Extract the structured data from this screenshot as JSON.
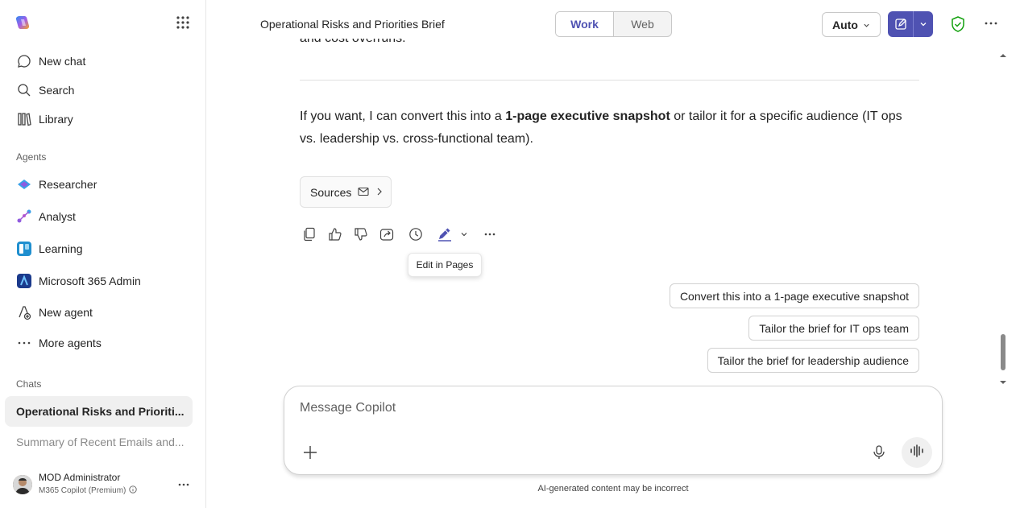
{
  "sidebar": {
    "nav": [
      {
        "label": "New chat",
        "icon": "chat-bubble-icon"
      },
      {
        "label": "Search",
        "icon": "search-icon"
      },
      {
        "label": "Library",
        "icon": "library-icon"
      }
    ],
    "agents_heading": "Agents",
    "agents": [
      {
        "label": "Researcher",
        "icon": "researcher-icon"
      },
      {
        "label": "Analyst",
        "icon": "analyst-icon"
      },
      {
        "label": "Learning",
        "icon": "learning-icon"
      },
      {
        "label": "Microsoft 365 Admin",
        "icon": "admin-icon"
      },
      {
        "label": "New agent",
        "icon": "new-agent-icon"
      },
      {
        "label": "More agents",
        "icon": "ellipsis-icon"
      }
    ],
    "chats_heading": "Chats",
    "chats": [
      {
        "label": "Operational Risks and Prioriti...",
        "active": true
      },
      {
        "label": "Summary of Recent Emails and...",
        "active": false
      }
    ],
    "user": {
      "name": "MOD Administrator",
      "plan": "M365 Copilot (Premium)"
    }
  },
  "header": {
    "title": "Operational Risks and Priorities Brief",
    "modes": [
      "Work",
      "Web"
    ],
    "selected_mode": "Work",
    "model": "Auto",
    "accent_color": "#4f52b2",
    "shield_color": "#13a10e"
  },
  "message": {
    "cut_line": "and cost overruns.",
    "para_before": "If you want, I can convert this into a ",
    "para_bold": "1-page executive snapshot",
    "para_after": " or tailor it for a specific audience (IT ops vs. leadership vs. cross-functional team).",
    "sources_label": "Sources"
  },
  "tooltip": "Edit in Pages",
  "suggestions": [
    "Convert this into a 1-page executive snapshot",
    "Tailor the brief for IT ops team",
    "Tailor the brief for leadership audience"
  ],
  "composer": {
    "placeholder": "Message Copilot"
  },
  "disclaimer": "AI-generated content may be incorrect"
}
